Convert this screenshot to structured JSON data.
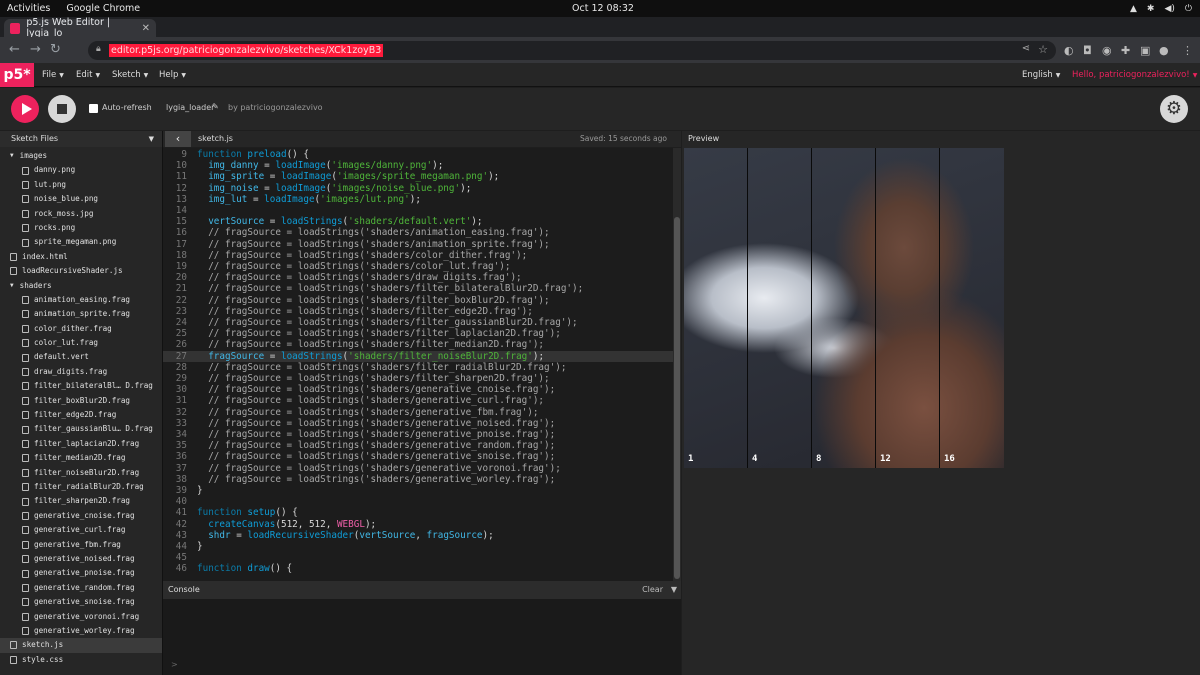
{
  "os": {
    "activities": "Activities",
    "app": "Google Chrome",
    "clock": "Oct 12  08:32"
  },
  "browser": {
    "tab_title": "p5.js Web Editor | lygia_lo",
    "url": "editor.p5js.org/patriciogonzalezvivo/sketches/XCk1zoyB3"
  },
  "menubar": {
    "logo": "p5*",
    "items": [
      "File",
      "Edit",
      "Sketch",
      "Help"
    ],
    "language": "English",
    "greeting": "Hello, patriciogonzalezvivo!"
  },
  "sketch_toolbar": {
    "auto_refresh_label": "Auto-refresh",
    "project_name": "lygia_loader",
    "byline": "by patriciogonzalezvivo"
  },
  "sidebar": {
    "title": "Sketch Files",
    "files": [
      {
        "name": "images",
        "type": "folder",
        "depth": 0
      },
      {
        "name": "danny.png",
        "type": "file",
        "depth": 1
      },
      {
        "name": "lut.png",
        "type": "file",
        "depth": 1
      },
      {
        "name": "noise_blue.png",
        "type": "file",
        "depth": 1
      },
      {
        "name": "rock_moss.jpg",
        "type": "file",
        "depth": 1
      },
      {
        "name": "rocks.png",
        "type": "file",
        "depth": 1
      },
      {
        "name": "sprite_megaman.png",
        "type": "file",
        "depth": 1
      },
      {
        "name": "index.html",
        "type": "file",
        "depth": 0
      },
      {
        "name": "loadRecursiveShader.js",
        "type": "file",
        "depth": 0
      },
      {
        "name": "shaders",
        "type": "folder",
        "depth": 0
      },
      {
        "name": "animation_easing.frag",
        "type": "file",
        "depth": 1
      },
      {
        "name": "animation_sprite.frag",
        "type": "file",
        "depth": 1
      },
      {
        "name": "color_dither.frag",
        "type": "file",
        "depth": 1
      },
      {
        "name": "color_lut.frag",
        "type": "file",
        "depth": 1
      },
      {
        "name": "default.vert",
        "type": "file",
        "depth": 1
      },
      {
        "name": "draw_digits.frag",
        "type": "file",
        "depth": 1
      },
      {
        "name": "filter_bilateralBl… D.frag",
        "type": "file",
        "depth": 1
      },
      {
        "name": "filter_boxBlur2D.frag",
        "type": "file",
        "depth": 1
      },
      {
        "name": "filter_edge2D.frag",
        "type": "file",
        "depth": 1
      },
      {
        "name": "filter_gaussianBlu… D.frag",
        "type": "file",
        "depth": 1
      },
      {
        "name": "filter_laplacian2D.frag",
        "type": "file",
        "depth": 1
      },
      {
        "name": "filter_median2D.frag",
        "type": "file",
        "depth": 1
      },
      {
        "name": "filter_noiseBlur2D.frag",
        "type": "file",
        "depth": 1
      },
      {
        "name": "filter_radialBlur2D.frag",
        "type": "file",
        "depth": 1
      },
      {
        "name": "filter_sharpen2D.frag",
        "type": "file",
        "depth": 1
      },
      {
        "name": "generative_cnoise.frag",
        "type": "file",
        "depth": 1
      },
      {
        "name": "generative_curl.frag",
        "type": "file",
        "depth": 1
      },
      {
        "name": "generative_fbm.frag",
        "type": "file",
        "depth": 1
      },
      {
        "name": "generative_noised.frag",
        "type": "file",
        "depth": 1
      },
      {
        "name": "generative_pnoise.frag",
        "type": "file",
        "depth": 1
      },
      {
        "name": "generative_random.frag",
        "type": "file",
        "depth": 1
      },
      {
        "name": "generative_snoise.frag",
        "type": "file",
        "depth": 1
      },
      {
        "name": "generative_voronoi.frag",
        "type": "file",
        "depth": 1
      },
      {
        "name": "generative_worley.frag",
        "type": "file",
        "depth": 1
      },
      {
        "name": "sketch.js",
        "type": "file",
        "depth": 0,
        "selected": true
      },
      {
        "name": "style.css",
        "type": "file",
        "depth": 0
      }
    ]
  },
  "editor": {
    "file_name": "sketch.js",
    "saved_status": "Saved: 15 seconds ago",
    "active_line": 27,
    "lines": [
      {
        "n": 9,
        "tokens": [
          [
            "kw",
            "function "
          ],
          [
            "fn",
            "preload"
          ],
          [
            "id",
            "() {"
          ]
        ]
      },
      {
        "n": 10,
        "tokens": [
          [
            "idb",
            "  img_danny"
          ],
          [
            "id",
            " = "
          ],
          [
            "fn",
            "loadImage"
          ],
          [
            "id",
            "("
          ],
          [
            "str",
            "'images/danny.png'"
          ],
          [
            "id",
            ");"
          ]
        ]
      },
      {
        "n": 11,
        "tokens": [
          [
            "idb",
            "  img_sprite"
          ],
          [
            "id",
            " = "
          ],
          [
            "fn",
            "loadImage"
          ],
          [
            "id",
            "("
          ],
          [
            "str",
            "'images/sprite_megaman.png'"
          ],
          [
            "id",
            ");"
          ]
        ]
      },
      {
        "n": 12,
        "tokens": [
          [
            "idb",
            "  img_noise"
          ],
          [
            "id",
            " = "
          ],
          [
            "fn",
            "loadImage"
          ],
          [
            "id",
            "("
          ],
          [
            "str",
            "'images/noise_blue.png'"
          ],
          [
            "id",
            ");"
          ]
        ]
      },
      {
        "n": 13,
        "tokens": [
          [
            "idb",
            "  img_lut"
          ],
          [
            "id",
            " = "
          ],
          [
            "fn",
            "loadImage"
          ],
          [
            "id",
            "("
          ],
          [
            "str",
            "'images/lut.png'"
          ],
          [
            "id",
            ");"
          ]
        ]
      },
      {
        "n": 14,
        "tokens": []
      },
      {
        "n": 15,
        "tokens": [
          [
            "idb",
            "  vertSource"
          ],
          [
            "id",
            " = "
          ],
          [
            "fn",
            "loadStrings"
          ],
          [
            "id",
            "("
          ],
          [
            "str",
            "'shaders/default.vert'"
          ],
          [
            "id",
            ");"
          ]
        ]
      },
      {
        "n": 16,
        "tokens": [
          [
            "cm",
            "  // fragSource = loadStrings('shaders/animation_easing.frag');"
          ]
        ]
      },
      {
        "n": 17,
        "tokens": [
          [
            "cm",
            "  // fragSource = loadStrings('shaders/animation_sprite.frag');"
          ]
        ]
      },
      {
        "n": 18,
        "tokens": [
          [
            "cm",
            "  // fragSource = loadStrings('shaders/color_dither.frag');"
          ]
        ]
      },
      {
        "n": 19,
        "tokens": [
          [
            "cm",
            "  // fragSource = loadStrings('shaders/color_lut.frag');"
          ]
        ]
      },
      {
        "n": 20,
        "tokens": [
          [
            "cm",
            "  // fragSource = loadStrings('shaders/draw_digits.frag');"
          ]
        ]
      },
      {
        "n": 21,
        "tokens": [
          [
            "cm",
            "  // fragSource = loadStrings('shaders/filter_bilateralBlur2D.frag');"
          ]
        ]
      },
      {
        "n": 22,
        "tokens": [
          [
            "cm",
            "  // fragSource = loadStrings('shaders/filter_boxBlur2D.frag');"
          ]
        ]
      },
      {
        "n": 23,
        "tokens": [
          [
            "cm",
            "  // fragSource = loadStrings('shaders/filter_edge2D.frag');"
          ]
        ]
      },
      {
        "n": 24,
        "tokens": [
          [
            "cm",
            "  // fragSource = loadStrings('shaders/filter_gaussianBlur2D.frag');"
          ]
        ]
      },
      {
        "n": 25,
        "tokens": [
          [
            "cm",
            "  // fragSource = loadStrings('shaders/filter_laplacian2D.frag');"
          ]
        ]
      },
      {
        "n": 26,
        "tokens": [
          [
            "cm",
            "  // fragSource = loadStrings('shaders/filter_median2D.frag');"
          ]
        ]
      },
      {
        "n": 27,
        "tokens": [
          [
            "idb",
            "  fragSource"
          ],
          [
            "id",
            " = "
          ],
          [
            "fn",
            "loadStrings"
          ],
          [
            "id",
            "("
          ],
          [
            "str",
            "'shaders/filter_noiseBlur2D.frag'"
          ],
          [
            "id",
            ");"
          ]
        ]
      },
      {
        "n": 28,
        "tokens": [
          [
            "cm",
            "  // fragSource = loadStrings('shaders/filter_radialBlur2D.frag');"
          ]
        ]
      },
      {
        "n": 29,
        "tokens": [
          [
            "cm",
            "  // fragSource = loadStrings('shaders/filter_sharpen2D.frag');"
          ]
        ]
      },
      {
        "n": 30,
        "tokens": [
          [
            "cm",
            "  // fragSource = loadStrings('shaders/generative_cnoise.frag');"
          ]
        ]
      },
      {
        "n": 31,
        "tokens": [
          [
            "cm",
            "  // fragSource = loadStrings('shaders/generative_curl.frag');"
          ]
        ]
      },
      {
        "n": 32,
        "tokens": [
          [
            "cm",
            "  // fragSource = loadStrings('shaders/generative_fbm.frag');"
          ]
        ]
      },
      {
        "n": 33,
        "tokens": [
          [
            "cm",
            "  // fragSource = loadStrings('shaders/generative_noised.frag');"
          ]
        ]
      },
      {
        "n": 34,
        "tokens": [
          [
            "cm",
            "  // fragSource = loadStrings('shaders/generative_pnoise.frag');"
          ]
        ]
      },
      {
        "n": 35,
        "tokens": [
          [
            "cm",
            "  // fragSource = loadStrings('shaders/generative_random.frag');"
          ]
        ]
      },
      {
        "n": 36,
        "tokens": [
          [
            "cm",
            "  // fragSource = loadStrings('shaders/generative_snoise.frag');"
          ]
        ]
      },
      {
        "n": 37,
        "tokens": [
          [
            "cm",
            "  // fragSource = loadStrings('shaders/generative_voronoi.frag');"
          ]
        ]
      },
      {
        "n": 38,
        "tokens": [
          [
            "cm",
            "  // fragSource = loadStrings('shaders/generative_worley.frag');"
          ]
        ]
      },
      {
        "n": 39,
        "tokens": [
          [
            "id",
            "}"
          ]
        ]
      },
      {
        "n": 40,
        "tokens": []
      },
      {
        "n": 41,
        "tokens": [
          [
            "kw",
            "function "
          ],
          [
            "fn",
            "setup"
          ],
          [
            "id",
            "() {"
          ]
        ]
      },
      {
        "n": 42,
        "tokens": [
          [
            "fn",
            "  createCanvas"
          ],
          [
            "id",
            "(512, 512, "
          ],
          [
            "mg",
            "WEBGL"
          ],
          [
            "id",
            ");"
          ]
        ]
      },
      {
        "n": 43,
        "tokens": [
          [
            "idb",
            "  shdr"
          ],
          [
            "id",
            " = "
          ],
          [
            "fn",
            "loadRecursiveShader"
          ],
          [
            "id",
            "("
          ],
          [
            "idb",
            "vertSource"
          ],
          [
            "id",
            ", "
          ],
          [
            "idb",
            "fragSource"
          ],
          [
            "id",
            ");"
          ]
        ]
      },
      {
        "n": 44,
        "tokens": [
          [
            "id",
            "}"
          ]
        ]
      },
      {
        "n": 45,
        "tokens": []
      },
      {
        "n": 46,
        "tokens": [
          [
            "kw",
            "function "
          ],
          [
            "fn",
            "draw"
          ],
          [
            "id",
            "() {"
          ]
        ]
      }
    ]
  },
  "console": {
    "title": "Console",
    "clear_label": "Clear",
    "prompt": ">"
  },
  "preview": {
    "title": "Preview",
    "column_labels": [
      "1",
      "4",
      "8",
      "12",
      "16"
    ]
  },
  "colors": {
    "accent": "#ed225d",
    "background": "#1e1e1e",
    "url_highlight": "#ff1a3b"
  }
}
